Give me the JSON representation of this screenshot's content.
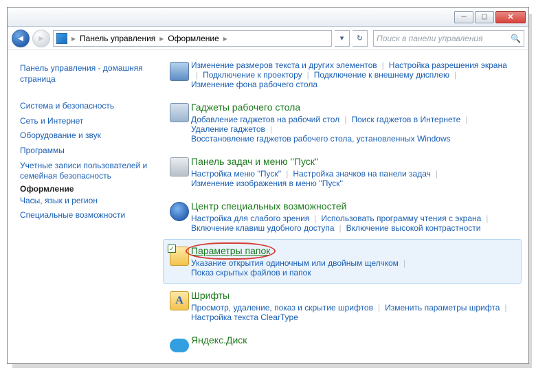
{
  "breadcrumbs": [
    "Панель управления",
    "Оформление"
  ],
  "search_placeholder": "Поиск в панели управления",
  "sidebar": {
    "header": "Панель управления - домашняя страница",
    "items": [
      "Система и безопасность",
      "Сеть и Интернет",
      "Оборудование и звук",
      "Программы",
      "Учетные записи пользователей и семейная безопасность",
      "Оформление",
      "Часы, язык и регион",
      "Специальные возможности"
    ],
    "current_index": 5
  },
  "sections": [
    {
      "id": "display",
      "title": "",
      "links": [
        "Изменение размеров текста и других элементов",
        "Настройка разрешения экрана",
        "Подключение к проектору",
        "Подключение к внешнему дисплею",
        "Изменение фона рабочего стола"
      ]
    },
    {
      "id": "gadgets",
      "title": "Гаджеты рабочего стола",
      "links": [
        "Добавление гаджетов на рабочий стол",
        "Поиск гаджетов в Интернете",
        "Удаление гаджетов",
        "Восстановление гаджетов рабочего стола, установленных Windows"
      ]
    },
    {
      "id": "taskbar",
      "title": "Панель задач и меню ''Пуск''",
      "links": [
        "Настройка меню ''Пуск''",
        "Настройка значков на панели задач",
        "Изменение изображения в меню ''Пуск''"
      ]
    },
    {
      "id": "ease",
      "title": "Центр специальных возможностей",
      "links": [
        "Настройка для слабого зрения",
        "Использовать программу чтения с экрана",
        "Включение клавиш удобного доступа",
        "Включение высокой контрастности"
      ]
    },
    {
      "id": "folder",
      "title": "Параметры папок",
      "highlighted": true,
      "links": [
        "Указание открытия одиночным или двойным щелчком",
        "Показ скрытых файлов и папок"
      ]
    },
    {
      "id": "fonts",
      "title": "Шрифты",
      "links": [
        "Просмотр, удаление, показ и скрытие шрифтов",
        "Изменить параметры шрифта",
        "Настройка текста ClearType"
      ]
    },
    {
      "id": "yadisk",
      "title": "Яндекс.Диск",
      "links": []
    }
  ]
}
